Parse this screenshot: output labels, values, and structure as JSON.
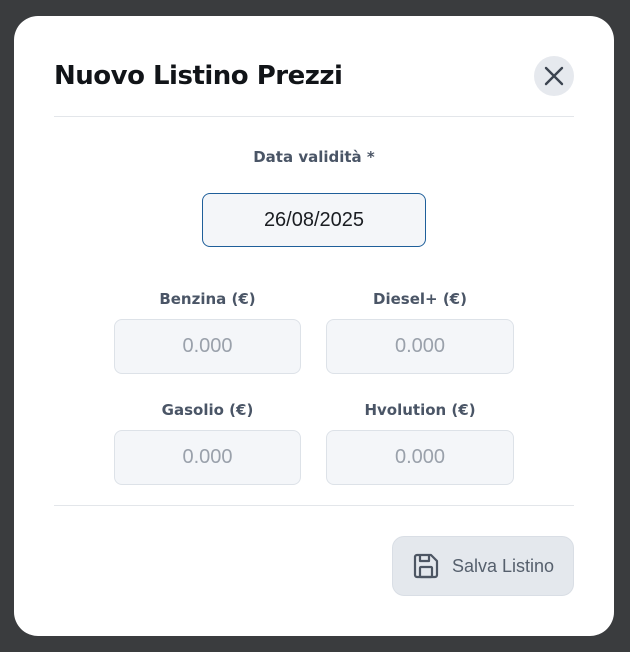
{
  "modal": {
    "title": "Nuovo Listino Prezzi",
    "close_icon": "close-icon"
  },
  "form": {
    "date": {
      "label": "Data validità *",
      "value": "26/08/2025"
    },
    "prices": [
      {
        "label": "Benzina (€)",
        "placeholder": "0.000"
      },
      {
        "label": "Diesel+ (€)",
        "placeholder": "0.000"
      },
      {
        "label": "Gasolio (€)",
        "placeholder": "0.000"
      },
      {
        "label": "Hvolution (€)",
        "placeholder": "0.000"
      }
    ]
  },
  "footer": {
    "save_label": "Salva Listino",
    "save_icon": "floppy-disk-icon"
  },
  "colors": {
    "backdrop": "#3a3c3e",
    "modal_bg": "#ffffff",
    "focus_border": "#1f5f9a",
    "input_bg": "#f4f6f9",
    "button_bg": "#e4e8ed"
  }
}
